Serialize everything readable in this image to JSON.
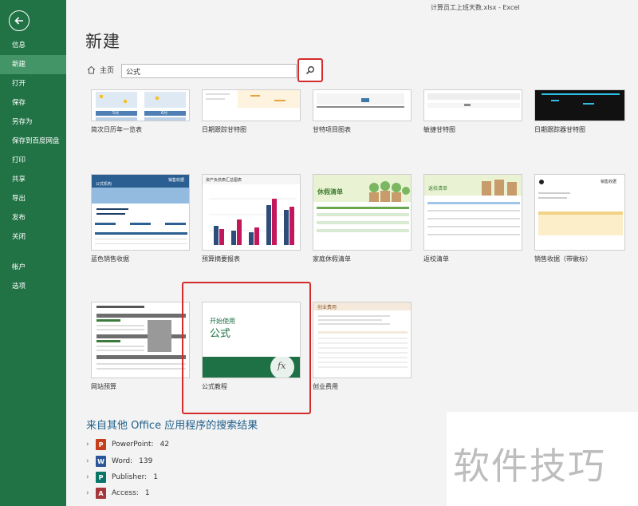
{
  "window": {
    "title": "计算员工上班天数.xlsx - Excel"
  },
  "sidebar": {
    "items": [
      {
        "label": "信息"
      },
      {
        "label": "新建"
      },
      {
        "label": "打开"
      },
      {
        "label": "保存"
      },
      {
        "label": "另存为"
      },
      {
        "label": "保存到百度网盘"
      },
      {
        "label": "打印"
      },
      {
        "label": "共享"
      },
      {
        "label": "导出"
      },
      {
        "label": "发布"
      },
      {
        "label": "关闭"
      },
      {
        "label": "帐户"
      },
      {
        "label": "选项"
      }
    ],
    "selected": "新建"
  },
  "main": {
    "title": "新建",
    "home_label": "主页",
    "search_value": "公式"
  },
  "templates": [
    {
      "label": "简次日历年一览表"
    },
    {
      "label": "日期跟踪甘特图"
    },
    {
      "label": "甘特项目图表"
    },
    {
      "label": "敏捷甘特图"
    },
    {
      "label": "日期跟踪器甘特图"
    },
    {
      "label": "蓝色销售收据"
    },
    {
      "label": "预算摘要报表"
    },
    {
      "label": "家庭休假清单"
    },
    {
      "label": "返校清单"
    },
    {
      "label": "销售收据（带徽标）"
    },
    {
      "label": "网站预算"
    },
    {
      "label": "公式教程"
    },
    {
      "label": "创业费用"
    }
  ],
  "thumb_text": {
    "calendar_months": [
      "5月",
      "6月"
    ],
    "sales_receipt": "公式机构",
    "sales_receipt_title": "销售收据",
    "budget_summary": "资产负债表汇总图表",
    "family": "休假清单",
    "school": "返校清单",
    "receipt_logo": "销售收据",
    "formula_start": "开始使用",
    "formula_main": "公式",
    "formula_icon": "fx",
    "startup": "创业费用"
  },
  "other_results": {
    "title": "来自其他 Office 应用程序的搜索结果",
    "apps": [
      {
        "name": "PowerPoint:",
        "count": "42",
        "letter": "P",
        "color": "#c43e1c"
      },
      {
        "name": "Word:",
        "count": "139",
        "letter": "W",
        "color": "#2b579a"
      },
      {
        "name": "Publisher:",
        "count": "1",
        "letter": "P",
        "color": "#077568"
      },
      {
        "name": "Access:",
        "count": "1",
        "letter": "A",
        "color": "#a4373a"
      }
    ]
  },
  "watermark": "软件技巧",
  "colors": {
    "excel_green": "#217346",
    "selected_nav": "#439467",
    "highlight_red": "#d32c2c"
  }
}
